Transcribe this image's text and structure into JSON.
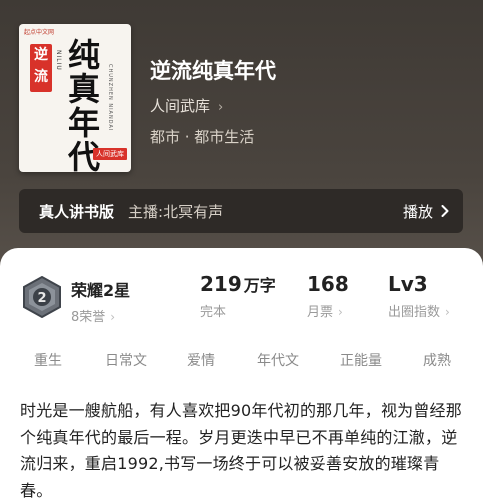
{
  "book": {
    "title": "逆流纯真年代",
    "author": "人间武库",
    "tags_line": "都市 · 都市生活",
    "cover": {
      "publisher": "起点中文网",
      "badge": "逆流",
      "title": "纯真年代",
      "pinyin": "NILIU",
      "subtitle": "CHUNZHEN NIANDAI",
      "author_tag": "人间武库"
    }
  },
  "audio": {
    "label": "真人讲书版",
    "narrator": "主播:北冥有声",
    "play_label": "播放"
  },
  "stats": {
    "honor": {
      "main": "荣耀2星",
      "sub": "8荣誉"
    },
    "words": {
      "value": "219",
      "unit": "万字",
      "label": "完本"
    },
    "tickets": {
      "value": "168",
      "label": "月票"
    },
    "level": {
      "value": "Lv3",
      "label": "出圈指数"
    }
  },
  "tags": [
    "重生",
    "日常文",
    "爱情",
    "年代文",
    "正能量",
    "成熟"
  ],
  "description": "时光是一艘航船，有人喜欢把90年代初的那几年，视为曾经那个纯真年代的最后一程。岁月更迭中早已不再单纯的江澈，逆流归来，重启1992,书写一场终于可以被妥善安放的璀璨青春。",
  "colors": {
    "hero_bg": "#4a443e",
    "audio_bar_bg": "#2e2a27",
    "badge_red": "#d8322a"
  }
}
